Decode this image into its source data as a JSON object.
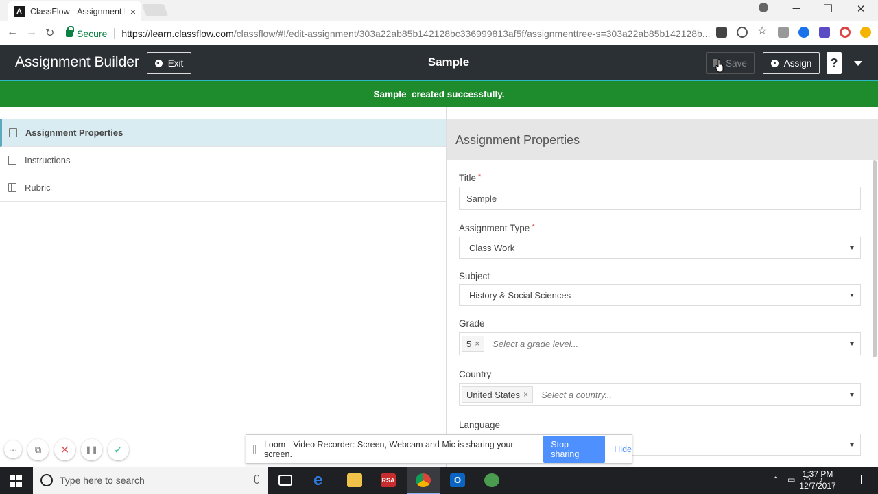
{
  "browser": {
    "tab_title": "ClassFlow - Assignment B",
    "tab_close": "×",
    "secure_label": "Secure",
    "url_domain": "https://learn.classflow.com",
    "url_rest": "/classflow/#!/edit-assignment/303a22ab85b142128bc336999813af5f/assignmenttree-s=303a22ab85b142128b...",
    "win_min": "─",
    "win_restore": "❐",
    "win_close": "✕",
    "nav_back": "←",
    "nav_forward": "→",
    "nav_reload": "↻"
  },
  "header": {
    "app_title": "Assignment Builder",
    "exit_label": "Exit",
    "doc_title": "Sample",
    "save_label": "Save",
    "assign_label": "Assign",
    "help_label": "?"
  },
  "banner": {
    "message": "Sample  created successfully."
  },
  "tree": {
    "items": [
      {
        "label": "Assignment Properties",
        "active": true
      },
      {
        "label": "Instructions",
        "active": false
      },
      {
        "label": "Rubric",
        "active": false
      }
    ]
  },
  "panel": {
    "title": "Assignment Properties",
    "title_field": {
      "label": "Title",
      "required": "*",
      "value": "Sample"
    },
    "type_field": {
      "label": "Assignment Type",
      "required": "*",
      "value": "Class Work"
    },
    "subject_field": {
      "label": "Subject",
      "value": "History & Social Sciences"
    },
    "grade_field": {
      "label": "Grade",
      "tag": "5",
      "tag_remove": "×",
      "placeholder": "Select a grade level..."
    },
    "country_field": {
      "label": "Country",
      "tag": "United States",
      "tag_remove": "×",
      "placeholder": "Select a country..."
    },
    "language_field": {
      "label": "Language"
    }
  },
  "loom": {
    "tools": [
      "···",
      "⧉",
      "✕",
      "❚❚",
      "✓"
    ],
    "message": "Loom - Video Recorder: Screen, Webcam and Mic is sharing your screen.",
    "stop_label": "Stop sharing",
    "hide_label": "Hide"
  },
  "taskbar": {
    "search_placeholder": "Type here to search",
    "time": "1:37 PM",
    "date": "12/7/2017"
  },
  "colors": {
    "header_bg": "#2b3035",
    "banner_bg": "#1e8c2c",
    "active_tree_bg": "#d9ecf2",
    "accent": "#2ab8c8",
    "loom_blue": "#4d90fe"
  }
}
